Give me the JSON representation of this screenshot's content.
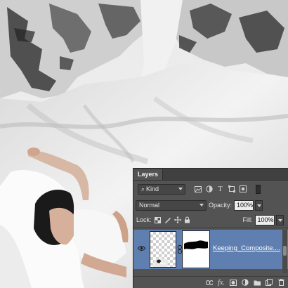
{
  "panel": {
    "tab_label": "Layers",
    "filter": {
      "label": "Kind",
      "icon": "search-icon"
    },
    "filter_icons": [
      "image-filter-icon",
      "adjustment-filter-icon",
      "type-filter-icon",
      "shape-filter-icon",
      "smart-object-filter-icon"
    ],
    "blend_mode": "Normal",
    "opacity_label": "Opacity:",
    "opacity_value": "100%",
    "lock_label": "Lock:",
    "fill_label": "Fill:",
    "fill_value": "100%",
    "layer": {
      "name": "Keeping_Composite....",
      "visible": true,
      "icons": [
        "eye-icon",
        "chain-link-icon"
      ]
    },
    "bottom_icons": [
      "link-layers-icon",
      "fx-icon",
      "add-mask-icon",
      "adjustment-layer-icon",
      "new-group-icon",
      "new-layer-icon",
      "delete-layer-icon"
    ],
    "fx_text": "fx.",
    "accent_color": "#5f7fb1",
    "panel_color": "#535353"
  }
}
